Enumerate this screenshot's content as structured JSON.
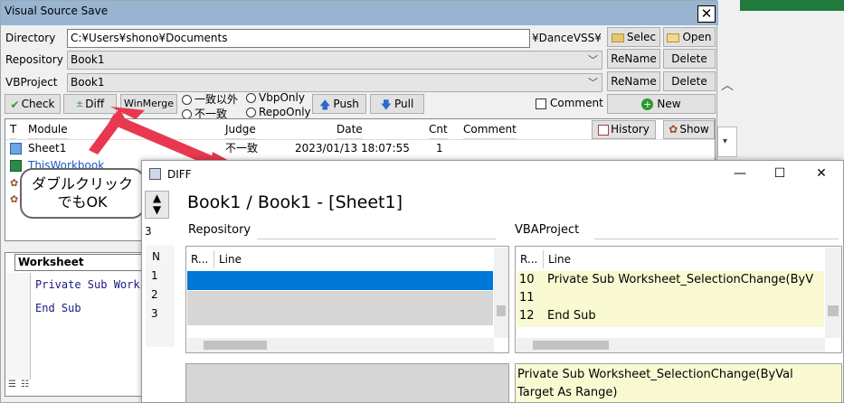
{
  "main_window": {
    "title": "Visual Source Save",
    "close_glyph": "✕",
    "directory": {
      "label": "Directory",
      "value": "C:¥Users¥shono¥Documents",
      "suffix": "¥DanceVSS¥",
      "select_label": "Selec",
      "open_label": "Open"
    },
    "repository": {
      "label": "Repository",
      "value": "Book1",
      "rename_label": "ReName",
      "delete_label": "Delete"
    },
    "vbproject": {
      "label": "VBProject",
      "value": "Book1",
      "rename_label": "ReName",
      "delete_label": "Delete"
    },
    "toolbar": {
      "check_label": "Check",
      "diff_label": "Diff",
      "winmerge_label": "WinMerge",
      "radio_mismatch": "一致以外",
      "radio_nomatch": "不一致",
      "radio_vbponly": "VbpOnly",
      "radio_repoonly": "RepoOnly",
      "push_label": "Push",
      "pull_label": "Pull",
      "comment_checkbox": "Comment",
      "new_label": "New"
    },
    "grid": {
      "headers": {
        "t": "T",
        "module": "Module",
        "judge": "Judge",
        "date": "Date",
        "cnt": "Cnt",
        "comment": "Comment"
      },
      "history_label": "History",
      "show_label": "Show",
      "rows": [
        {
          "module": "Sheet1",
          "judge": "不一致",
          "date": "2023/01/13 18:07:55",
          "cnt": "1"
        },
        {
          "module": "ThisWorkbook",
          "judge": "",
          "date": "",
          "cnt": ""
        }
      ]
    },
    "code_pane": {
      "header": "Worksheet",
      "lines": [
        "Private Sub Works",
        "End Sub"
      ]
    }
  },
  "callout": {
    "line1": "ダブルクリック",
    "line2": "でもOK"
  },
  "diff_window": {
    "title": "DIFF",
    "minimize": "—",
    "maximize": "☐",
    "close": "✕",
    "heading": "Book1 / Book1 - [Sheet1]",
    "count": "3",
    "left_label": "Repository",
    "right_label": "VBAProject",
    "n_header": "N",
    "n_values": [
      "1",
      "2",
      "3"
    ],
    "left_pane": {
      "col_r": "R...",
      "col_line": "Line"
    },
    "right_pane": {
      "col_r": "R...",
      "col_line": "Line",
      "rows": [
        {
          "r": "10",
          "line": "Private Sub Worksheet_SelectionChange(ByV"
        },
        {
          "r": "11",
          "line": ""
        },
        {
          "r": "12",
          "line": "End Sub"
        }
      ]
    },
    "detail_text_line1": "Private Sub Worksheet_SelectionChange(ByVal",
    "detail_text_line2": "Target As Range)"
  },
  "colors": {
    "title_bar": "#99b4d1",
    "arrow": "#e8384f",
    "selection": "#0078d7",
    "diff_highlight": "#fafad2"
  }
}
